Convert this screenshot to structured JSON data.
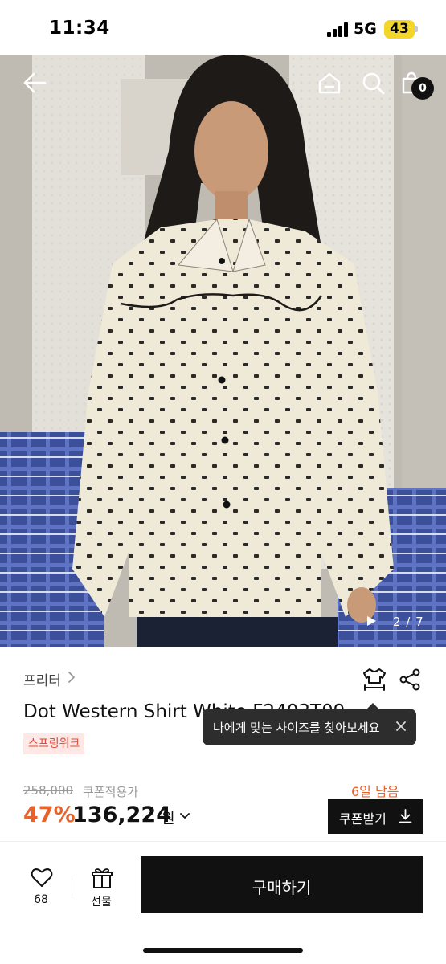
{
  "status_bar": {
    "time": "11:34",
    "network": "5G",
    "battery": "43"
  },
  "header": {
    "back_icon": "arrow-left-icon",
    "home_icon": "home-icon",
    "search_icon": "search-icon",
    "cart_icon": "shopping-bag-icon",
    "cart_count": "0"
  },
  "gallery": {
    "counter": "2 / 7",
    "play_icon": "play-icon"
  },
  "product": {
    "brand": "프리터",
    "title": "Dot Western Shirt White F2403T09",
    "tag": "스프링위크",
    "size_icon": "size-fit-icon",
    "share_icon": "share-icon"
  },
  "tooltip": {
    "text": "나에게 맞는 사이즈를 찾아보세요",
    "close_icon": "close-icon"
  },
  "pricing": {
    "original_price": "258,000",
    "coupon_label": "쿠폰적용가",
    "discount": "47%",
    "price": "136,224",
    "currency": "원",
    "days_left": "6일 남음",
    "coupon_button": "쿠폰받기"
  },
  "bottom_bar": {
    "wish_count": "68",
    "gift_label": "선물",
    "buy_label": "구매하기"
  },
  "colors": {
    "accent": "#e8622b",
    "tag_bg": "#fde8e6",
    "tag_text": "#e04a3a",
    "primary_button": "#111111",
    "battery": "#f4d629"
  }
}
